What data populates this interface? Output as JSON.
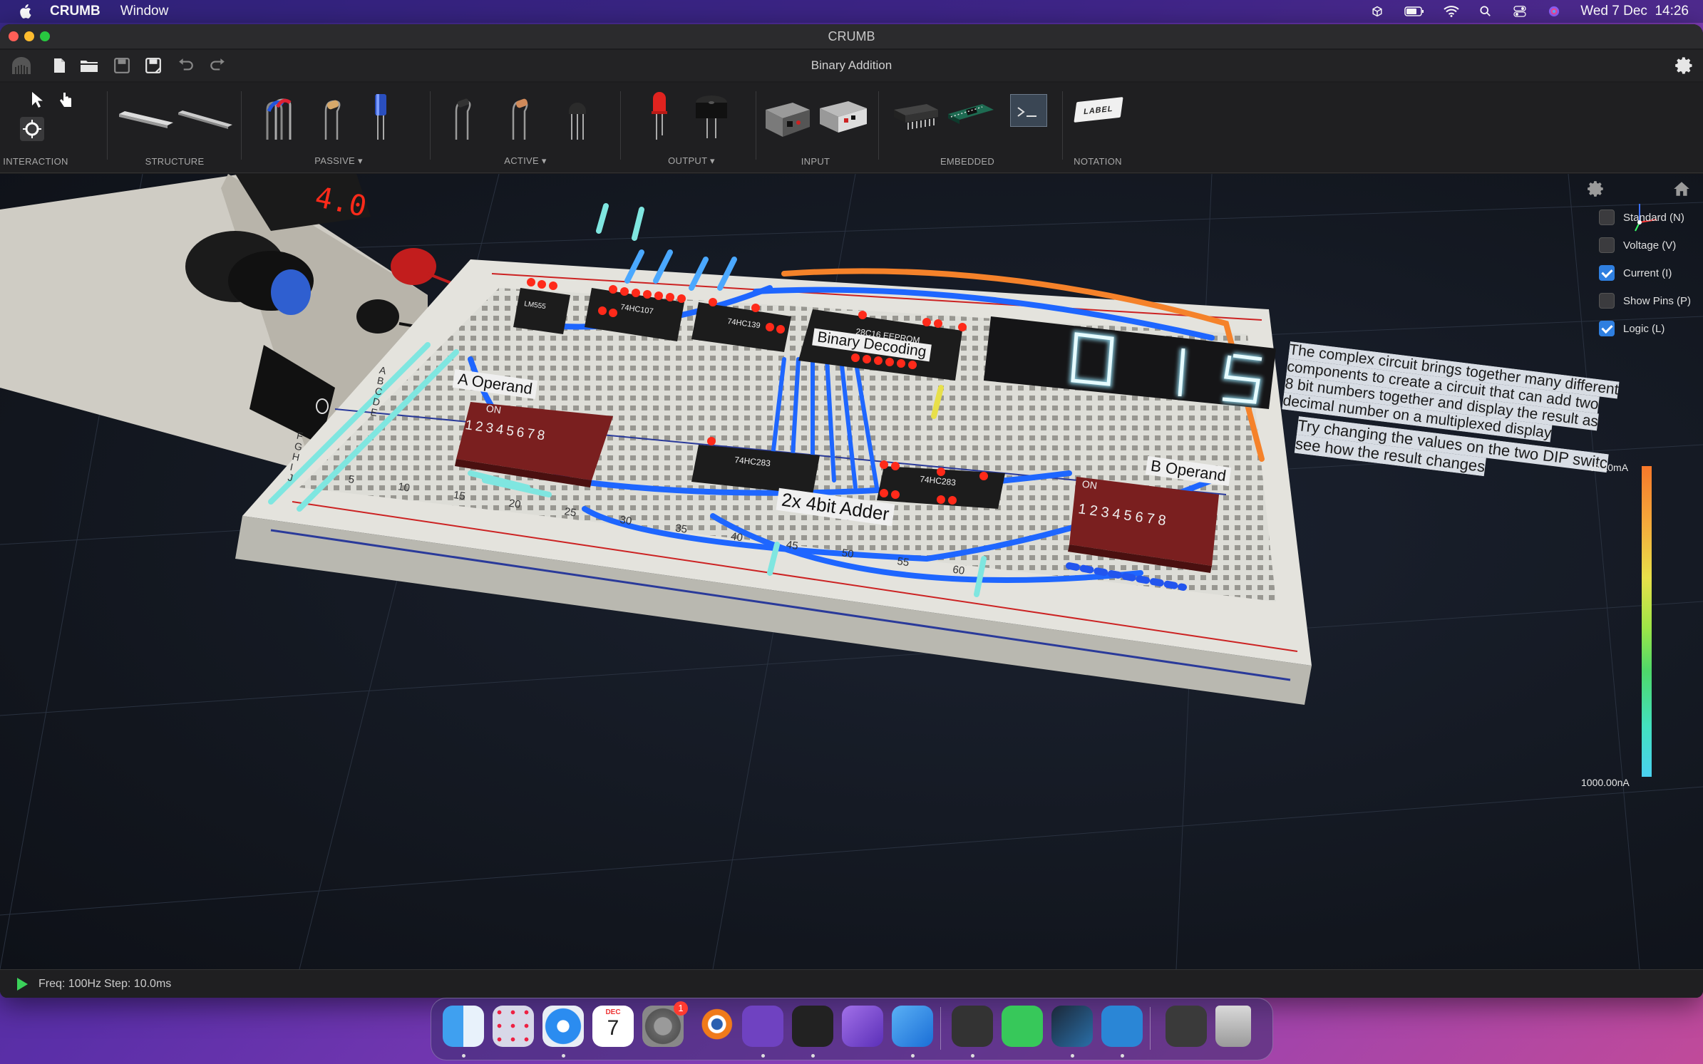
{
  "menubar": {
    "app_name": "CRUMB",
    "menus": [
      "Window"
    ],
    "datetime": "Wed 7 Dec  14:26",
    "status_icons": [
      "unity-icon",
      "battery-icon",
      "wifi-icon",
      "spotlight-search-icon",
      "control-center-icon",
      "siri-icon"
    ]
  },
  "window": {
    "title": "CRUMB",
    "document_title": "Binary Addition",
    "file_buttons": [
      "crumb-logo-icon",
      "new-file-icon",
      "open-folder-icon",
      "save-icon",
      "save-as-icon",
      "undo-icon",
      "redo-icon"
    ]
  },
  "toolbar": {
    "groups": [
      {
        "label": "INTERACTION"
      },
      {
        "label": "STRUCTURE"
      },
      {
        "label": "PASSIVE",
        "dropdown": true
      },
      {
        "label": "ACTIVE",
        "dropdown": true
      },
      {
        "label": "OUTPUT",
        "dropdown": true
      },
      {
        "label": "INPUT"
      },
      {
        "label": "EMBEDDED"
      },
      {
        "label": "NOTATION"
      }
    ],
    "notation_label_tag": "LABEL"
  },
  "viewport": {
    "checkboxes": [
      {
        "label": "Standard (N)",
        "checked": false
      },
      {
        "label": "Voltage (V)",
        "checked": false
      },
      {
        "label": "Current (I)",
        "checked": true
      },
      {
        "label": "Show Pins (P)",
        "checked": false
      },
      {
        "label": "Logic (L)",
        "checked": true
      }
    ],
    "colorbar": {
      "max": "48.20mA",
      "min": "1000.00nA",
      "colors": [
        "#f7782a",
        "#e8e04a",
        "#4ed86a",
        "#4ad0f0"
      ]
    },
    "scene_labels": {
      "a_operand": "A Operand",
      "b_operand": "B Operand",
      "adder": "2x 4bit Adder",
      "decoding": "Binary Decoding",
      "display_digits": "015",
      "power_display": "4.0",
      "note1": [
        "The complex circuit brings together many different",
        "components to create a circuit that can add two",
        "8 bit numbers together and display the result as",
        "decimal number on a multiplexed display"
      ],
      "note2": [
        "Try changing the values on the two DIP switc",
        "see how the result changes"
      ],
      "chips": [
        "LM555",
        "74HC107",
        "74HC139",
        "28C16 EEPROM",
        "74HC283",
        "74HC283"
      ],
      "dip_on": "ON",
      "dip_numbers": [
        "1",
        "2",
        "3",
        "4",
        "5",
        "6",
        "7",
        "8"
      ],
      "row_letters_left": [
        "A",
        "B",
        "C",
        "D",
        "E"
      ],
      "row_letters_lower": [
        "F",
        "G",
        "H",
        "I",
        "J"
      ],
      "column_numbers": [
        "5",
        "10",
        "15",
        "20",
        "25",
        "30",
        "35",
        "40",
        "45",
        "50",
        "55",
        "60"
      ]
    }
  },
  "status": {
    "freq": "Freq: 100Hz",
    "step": "Step: 10.0ms"
  },
  "dock": {
    "apps": [
      "finder-icon",
      "launchpad-icon",
      "safari-icon",
      "calendar-icon",
      "system-preferences-icon",
      "blender-icon",
      "github-desktop-icon",
      "unity-hub-icon",
      "visual-studio-icon",
      "xcode-icon",
      "unity-icon",
      "facetime-icon",
      "steam-icon",
      "crumb-icon",
      "screen-capture-icon",
      "trash-icon"
    ],
    "calendar_month": "DEC",
    "calendar_day": "7",
    "prefs_badge": "1"
  }
}
